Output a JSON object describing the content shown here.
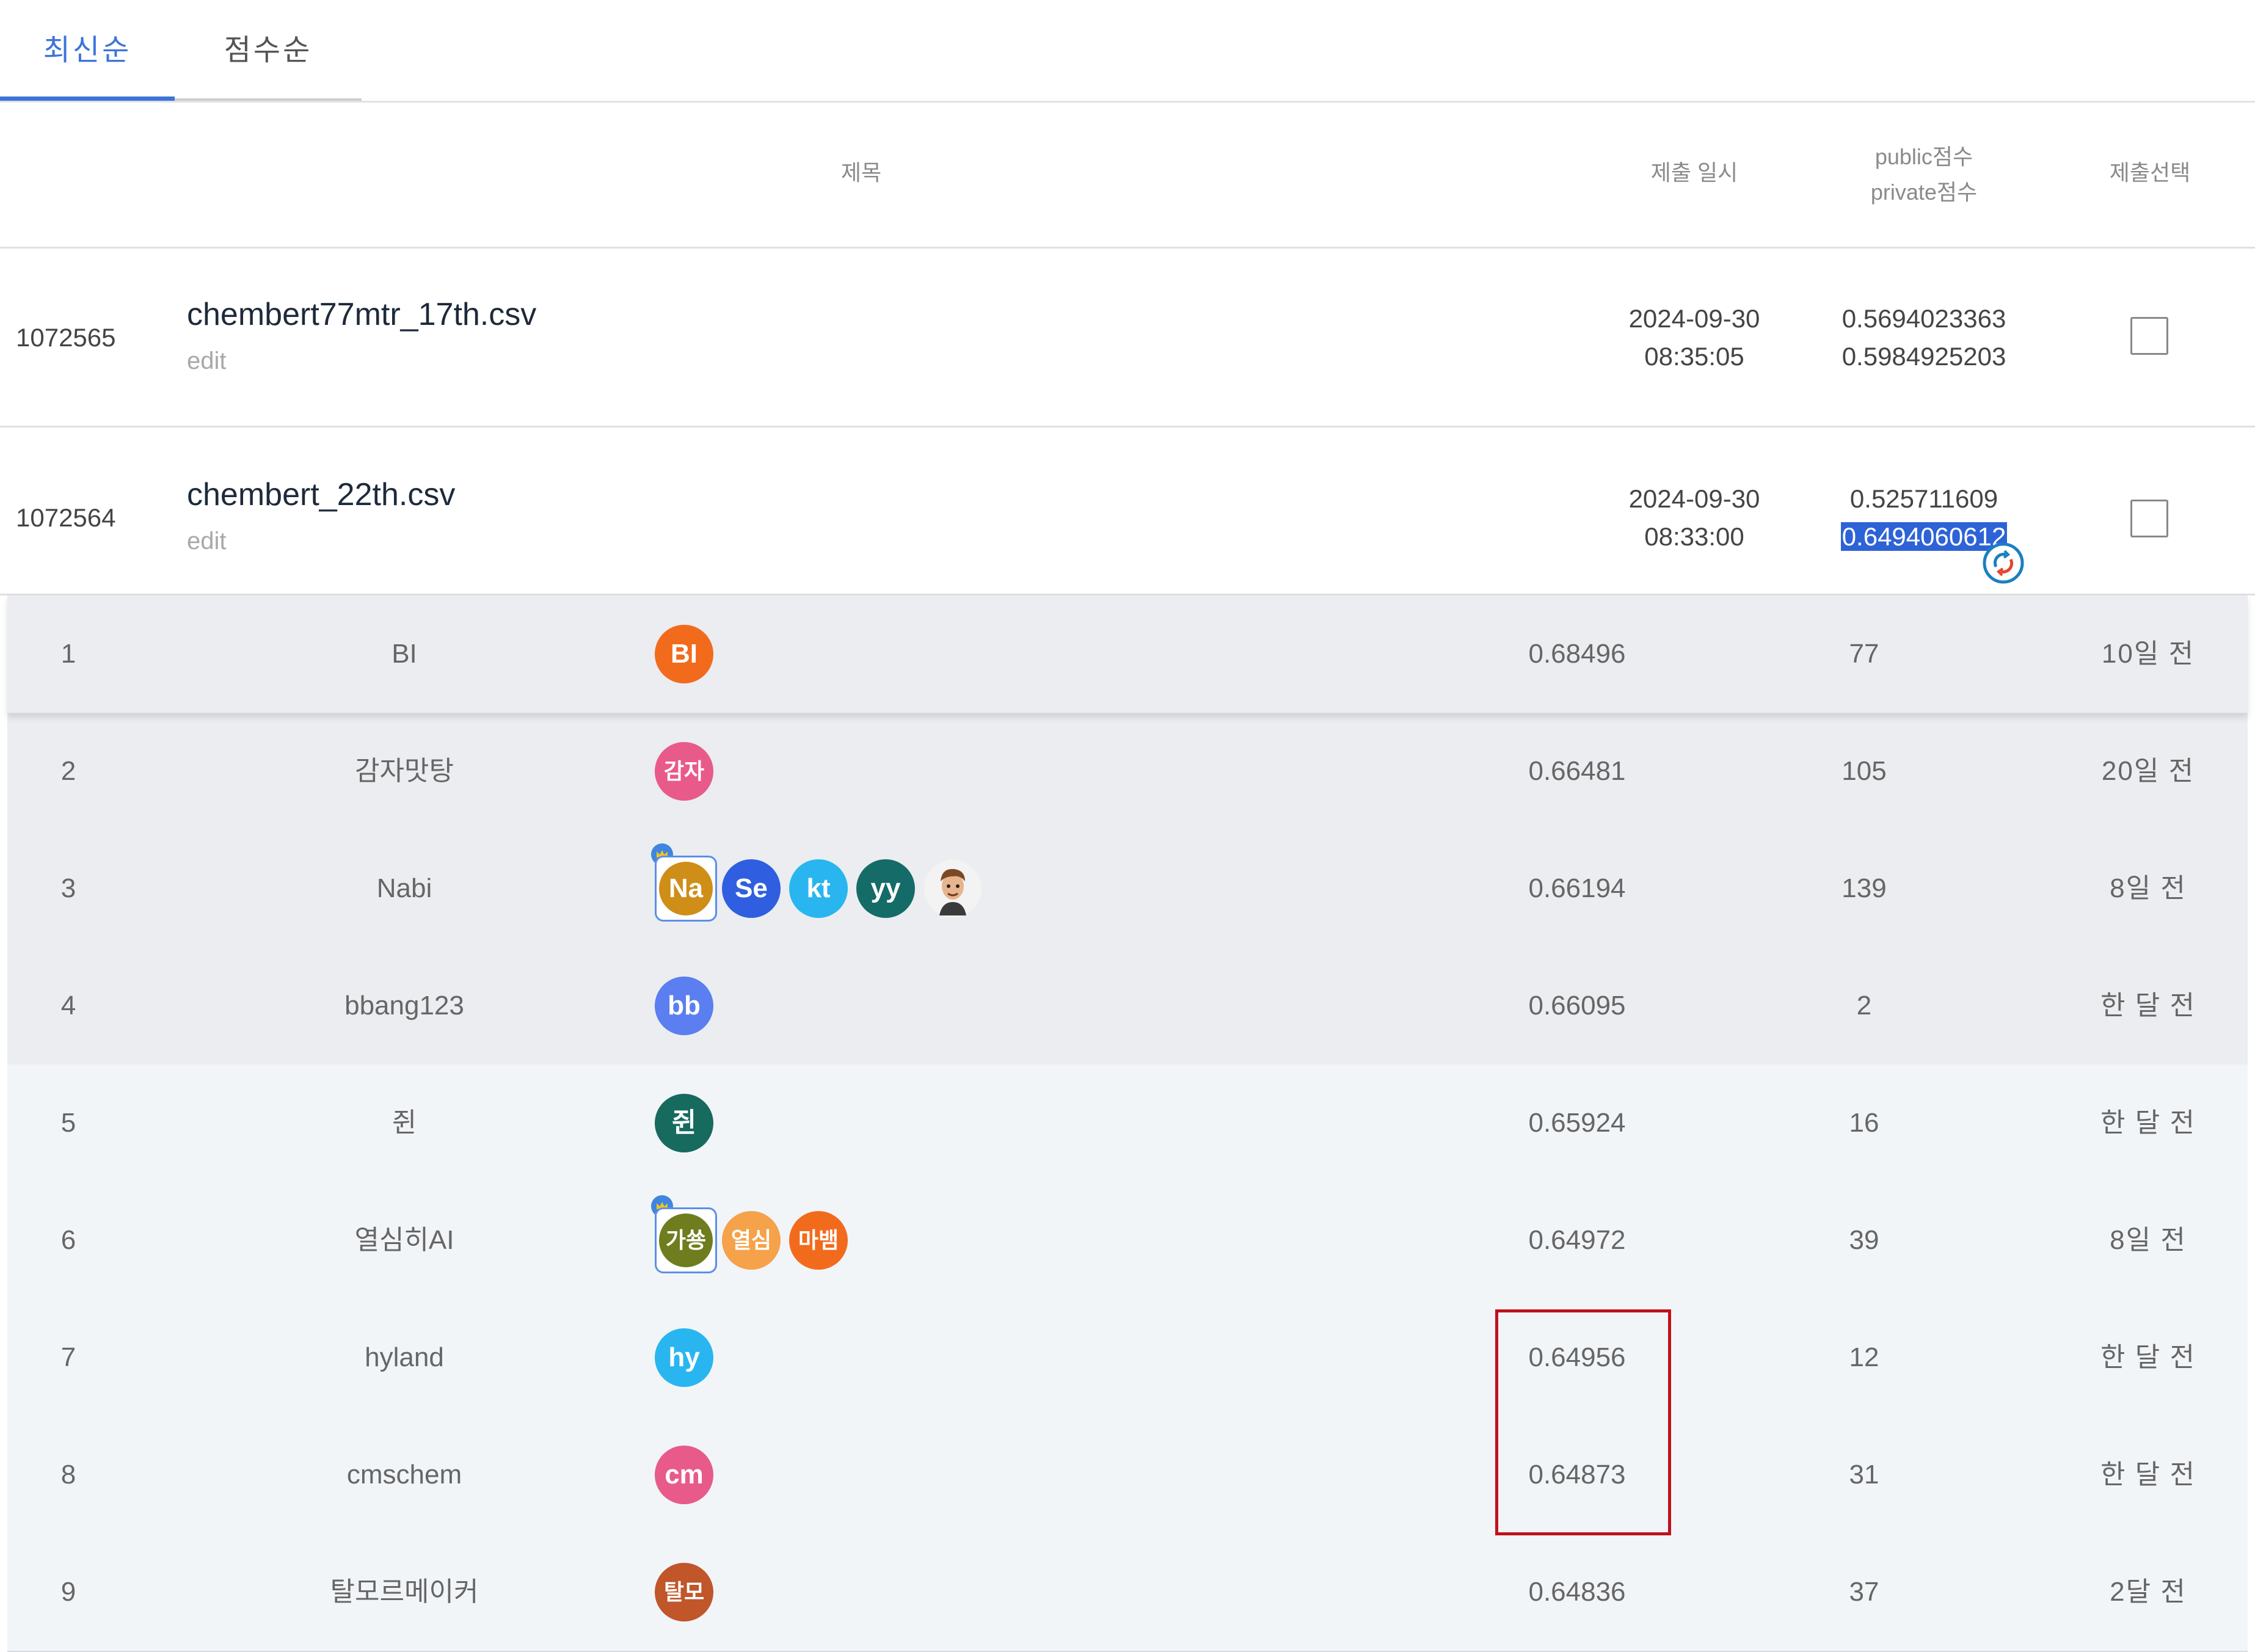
{
  "tabs": [
    {
      "label": "최신순",
      "active": true
    },
    {
      "label": "점수순",
      "active": false
    }
  ],
  "submissions_header": {
    "title_col": "제목",
    "date_col": "제출 일시",
    "public_col": "public점수",
    "private_col": "private점수",
    "select_col": "제출선택"
  },
  "submissions": [
    {
      "id": "1072565",
      "filename": "chembert77mtr_17th.csv",
      "edit": "edit",
      "date": "2024-09-30",
      "time": "08:35:05",
      "public": "0.5694023363",
      "private": "0.5984925203",
      "selected": false
    },
    {
      "id": "1072564",
      "filename": "chembert_22th.csv",
      "edit": "edit",
      "date": "2024-09-30",
      "time": "08:33:00",
      "public": "0.525711609",
      "private": "0.6494060612",
      "selected": false
    }
  ],
  "leaderboard": [
    {
      "rank": "1",
      "team": "BI",
      "members": [
        {
          "label": "BI",
          "color": "#f26b1d"
        }
      ],
      "score": "0.68496",
      "count": "77",
      "last": "10일 전"
    },
    {
      "rank": "2",
      "team": "감자맛탕",
      "members": [
        {
          "label": "감자",
          "color": "#e85a8a"
        }
      ],
      "score": "0.66481",
      "count": "105",
      "last": "20일 전"
    },
    {
      "rank": "3",
      "team": "Nabi",
      "members": [
        {
          "label": "Na",
          "color": "#cf8e17",
          "leader": true
        },
        {
          "label": "Se",
          "color": "#2f5fe0"
        },
        {
          "label": "kt",
          "color": "#29b6f0"
        },
        {
          "label": "yy",
          "color": "#156b67"
        },
        {
          "label": "",
          "color": "#f0f0f0",
          "photo": true
        }
      ],
      "score": "0.66194",
      "count": "139",
      "last": "8일 전"
    },
    {
      "rank": "4",
      "team": "bbang123",
      "members": [
        {
          "label": "bb",
          "color": "#5b7ef0"
        }
      ],
      "score": "0.66095",
      "count": "2",
      "last": "한 달 전"
    },
    {
      "rank": "5",
      "team": "쥔",
      "members": [
        {
          "label": "쥔",
          "color": "#176a5e"
        }
      ],
      "score": "0.65924",
      "count": "16",
      "last": "한 달 전"
    },
    {
      "rank": "6",
      "team": "열심히AI",
      "members": [
        {
          "label": "가쑝",
          "color": "#6f7d1e",
          "leader": true
        },
        {
          "label": "열심",
          "color": "#f5a24a"
        },
        {
          "label": "마뱀",
          "color": "#f26b1d"
        }
      ],
      "score": "0.64972",
      "count": "39",
      "last": "8일 전"
    },
    {
      "rank": "7",
      "team": "hyland",
      "members": [
        {
          "label": "hy",
          "color": "#29b6f0"
        }
      ],
      "score": "0.64956",
      "count": "12",
      "last": "한 달 전"
    },
    {
      "rank": "8",
      "team": "cmschem",
      "members": [
        {
          "label": "cm",
          "color": "#e85a8a"
        }
      ],
      "score": "0.64873",
      "count": "31",
      "last": "한 달 전"
    },
    {
      "rank": "9",
      "team": "탈모르메이커",
      "members": [
        {
          "label": "탈모",
          "color": "#c0562a"
        }
      ],
      "score": "0.64836",
      "count": "37",
      "last": "2달 전"
    }
  ]
}
